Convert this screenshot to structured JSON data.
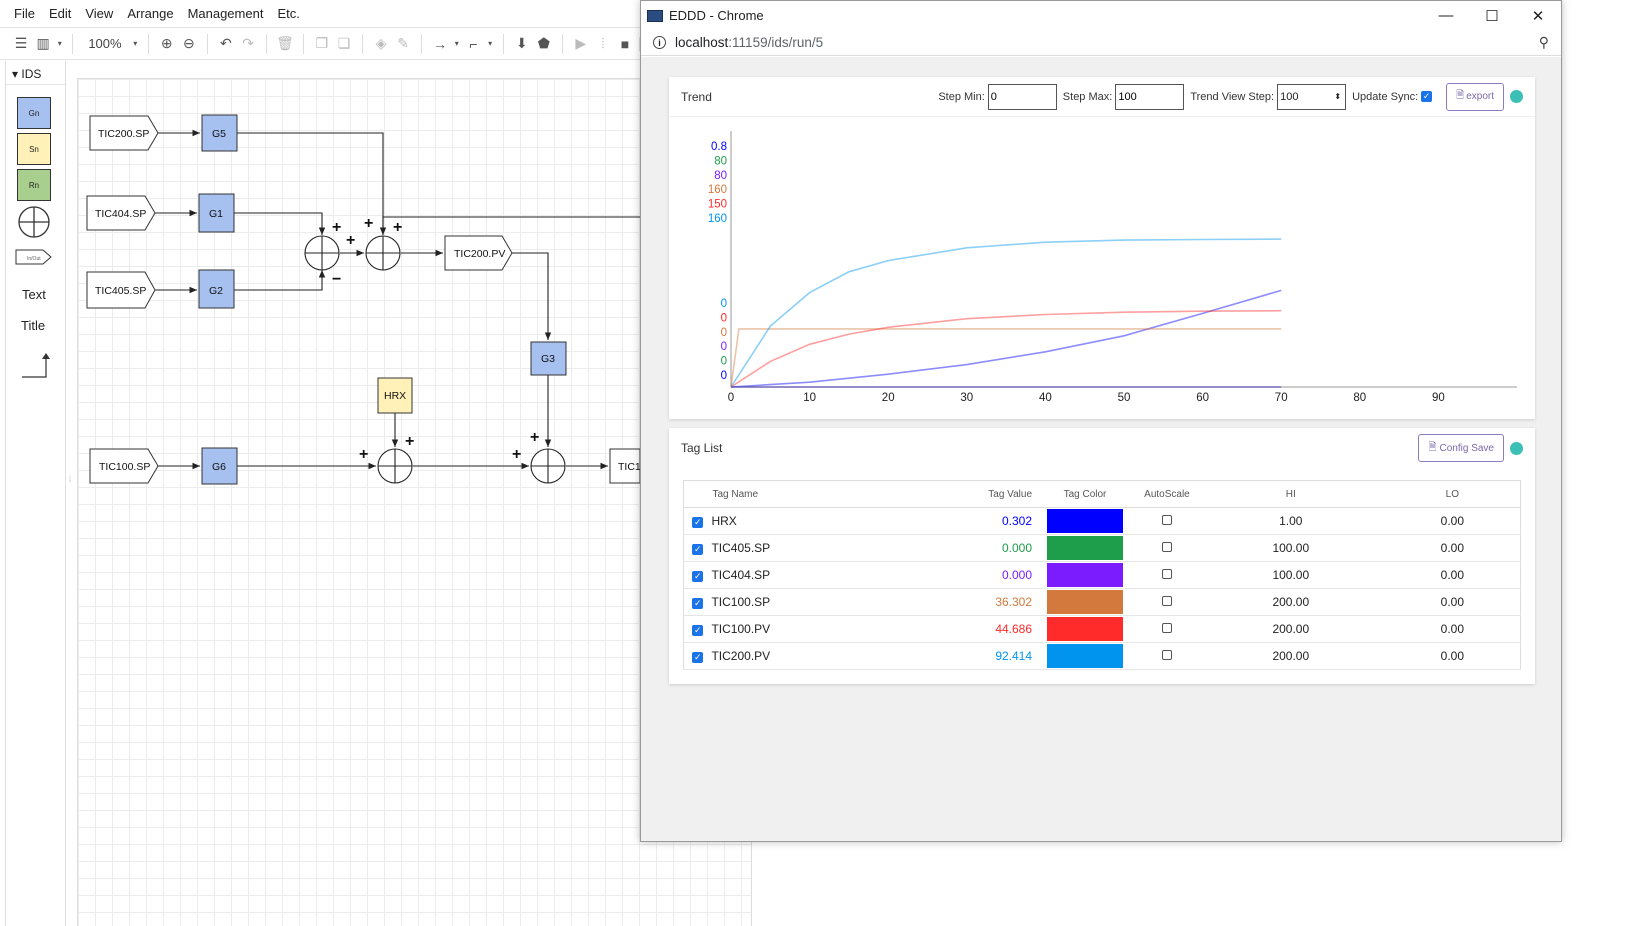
{
  "editor": {
    "menu": [
      "File",
      "Edit",
      "View",
      "Arrange",
      "Management",
      "Etc."
    ],
    "zoom": "100%",
    "palette": {
      "header": "IDS",
      "items": [
        "Gn",
        "Sn",
        "Rn"
      ],
      "text_item": "Text",
      "title_item": "Title",
      "io_label": "In/Out"
    },
    "diagram": {
      "nodes": [
        "TIC200.SP",
        "G5",
        "TIC404.SP",
        "G1",
        "TIC405.SP",
        "G2",
        "TIC200.PV",
        "G3",
        "HRX",
        "TIC100.SP",
        "G6",
        "TIC1"
      ],
      "signs": {
        "plus": "+",
        "minus": "−"
      }
    }
  },
  "popup": {
    "window_title": "EDDD - Chrome",
    "url_host": "localhost",
    "url_path": ":11159/ids/run/5",
    "trend": {
      "title": "Trend",
      "step_min_label": "Step Min:",
      "step_min": "0",
      "step_max_label": "Step Max:",
      "step_max": "100",
      "view_step_label": "Trend View Step:",
      "view_step": "100",
      "update_sync_label": "Update Sync:",
      "update_sync": true,
      "export_label": "export",
      "status_color": "#3cbfb4"
    },
    "tag_list": {
      "title": "Tag List",
      "config_save_label": "Config Save",
      "columns": [
        "Tag Name",
        "Tag Value",
        "Tag Color",
        "AutoScale",
        "HI",
        "LO"
      ],
      "rows": [
        {
          "name": "HRX",
          "value": "0.302",
          "color": "#0000ff",
          "hi": "1.00",
          "lo": "0.00"
        },
        {
          "name": "TIC405.SP",
          "value": "0.000",
          "color": "#1e9e4a",
          "hi": "100.00",
          "lo": "0.00"
        },
        {
          "name": "TIC404.SP",
          "value": "0.000",
          "color": "#7b1cff",
          "hi": "100.00",
          "lo": "0.00"
        },
        {
          "name": "TIC100.SP",
          "value": "36.302",
          "color": "#d4793e",
          "hi": "200.00",
          "lo": "0.00"
        },
        {
          "name": "TIC100.PV",
          "value": "44.686",
          "color": "#ff2a2a",
          "hi": "200.00",
          "lo": "0.00"
        },
        {
          "name": "TIC200.PV",
          "value": "92.414",
          "color": "#0094ee",
          "hi": "200.00",
          "lo": "0.00"
        }
      ]
    }
  },
  "chart_data": {
    "type": "line",
    "xlim": [
      0,
      100
    ],
    "x_ticks": [
      0,
      10,
      20,
      30,
      40,
      50,
      60,
      70,
      80,
      90
    ],
    "axis_max_labels": [
      {
        "text": "0.8",
        "color": "#0000ff"
      },
      {
        "text": "80",
        "color": "#1e9e4a"
      },
      {
        "text": "80",
        "color": "#7b1cff"
      },
      {
        "text": "160",
        "color": "#d4793e"
      },
      {
        "text": "150",
        "color": "#ff2a2a"
      },
      {
        "text": "160",
        "color": "#0094ee"
      }
    ],
    "axis_min_labels": [
      {
        "text": "0",
        "color": "#0094ee"
      },
      {
        "text": "0",
        "color": "#ff2a2a"
      },
      {
        "text": "0",
        "color": "#d4793e"
      },
      {
        "text": "0",
        "color": "#7b1cff"
      },
      {
        "text": "0",
        "color": "#1e9e4a"
      },
      {
        "text": "0",
        "color": "#0000ff"
      }
    ],
    "series": [
      {
        "name": "HRX",
        "color": "#0000ff",
        "ymax": 0.8,
        "x": [
          0,
          10,
          20,
          30,
          40,
          50,
          60,
          70
        ],
        "y": [
          0,
          0.015,
          0.04,
          0.07,
          0.11,
          0.16,
          0.23,
          0.302
        ]
      },
      {
        "name": "TIC405.SP",
        "color": "#1e9e4a",
        "ymax": 80,
        "x": [
          0,
          70
        ],
        "y": [
          0,
          0
        ]
      },
      {
        "name": "TIC404.SP",
        "color": "#7b1cff",
        "ymax": 80,
        "x": [
          0,
          70
        ],
        "y": [
          0,
          0
        ]
      },
      {
        "name": "TIC100.SP",
        "color": "#d4793e",
        "ymax": 160,
        "x": [
          0,
          1,
          70
        ],
        "y": [
          0,
          36.302,
          36.302
        ]
      },
      {
        "name": "TIC100.PV",
        "color": "#ff2a2a",
        "ymax": 150,
        "x": [
          0,
          5,
          10,
          15,
          20,
          30,
          40,
          50,
          60,
          70
        ],
        "y": [
          0,
          15,
          25,
          31,
          35,
          40,
          42.5,
          43.8,
          44.4,
          44.686
        ]
      },
      {
        "name": "TIC200.PV",
        "color": "#0094ee",
        "ymax": 160,
        "x": [
          0,
          5,
          10,
          15,
          20,
          30,
          40,
          50,
          60,
          70
        ],
        "y": [
          0,
          38,
          59,
          72,
          79,
          87,
          90.5,
          91.8,
          92.2,
          92.414
        ]
      }
    ]
  }
}
